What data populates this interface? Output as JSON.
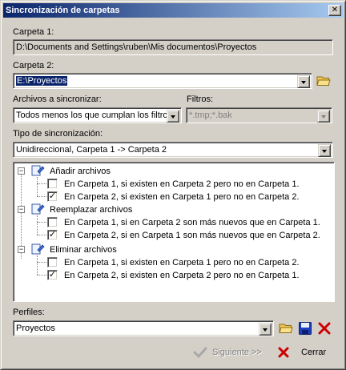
{
  "window": {
    "title": "Sincronización de carpetas",
    "close_glyph": "✕"
  },
  "folder1": {
    "label": "Carpeta 1:",
    "value": "D:\\Documents and Settings\\ruben\\Mis documentos\\Proyectos"
  },
  "folder2": {
    "label": "Carpeta 2:",
    "value": "E:\\Proyectos"
  },
  "files": {
    "label": "Archivos a sincronizar:",
    "value": "Todos menos los que cumplan los filtros"
  },
  "filters": {
    "label": "Filtros:",
    "value": "*.tmp;*.bak"
  },
  "sync_type": {
    "label": "Tipo de sincronización:",
    "value": "Unidireccional, Carpeta 1 -> Carpeta 2"
  },
  "tree": {
    "groups": [
      {
        "label": "Añadir archivos",
        "expander": "−",
        "items": [
          {
            "label": "En Carpeta 1, si existen en Carpeta 2 pero no en Carpeta 1.",
            "checked": false,
            "mark": ""
          },
          {
            "label": "En Carpeta 2, si existen en Carpeta 1 pero no en Carpeta 2.",
            "checked": true,
            "mark": "✓"
          }
        ]
      },
      {
        "label": "Reemplazar archivos",
        "expander": "−",
        "items": [
          {
            "label": "En Carpeta 1, si en Carpeta 2 son más nuevos que en Carpeta 1.",
            "checked": false,
            "mark": ""
          },
          {
            "label": "En Carpeta 2, si en Carpeta 1 son más nuevos que en Carpeta 2.",
            "checked": true,
            "mark": "✓"
          }
        ]
      },
      {
        "label": "Eliminar archivos",
        "expander": "−",
        "items": [
          {
            "label": "En Carpeta 1, si existen en Carpeta 1 pero no en Carpeta 2.",
            "checked": false,
            "mark": ""
          },
          {
            "label": "En Carpeta 2, si existen en Carpeta 2 pero no en Carpeta 1.",
            "checked": true,
            "mark": "✓"
          }
        ]
      }
    ]
  },
  "profiles": {
    "label": "Perfiles:",
    "value": "Proyectos"
  },
  "buttons": {
    "next": "Siguiente >>",
    "close": "Cerrar"
  },
  "colors": {
    "titlebar_start": "#0a246a",
    "titlebar_end": "#a6caf0",
    "checkmark": "#000000",
    "delete_red": "#cc0000",
    "save_blue": "#1f3fbf",
    "folder_yellow": "#f2c94c"
  }
}
